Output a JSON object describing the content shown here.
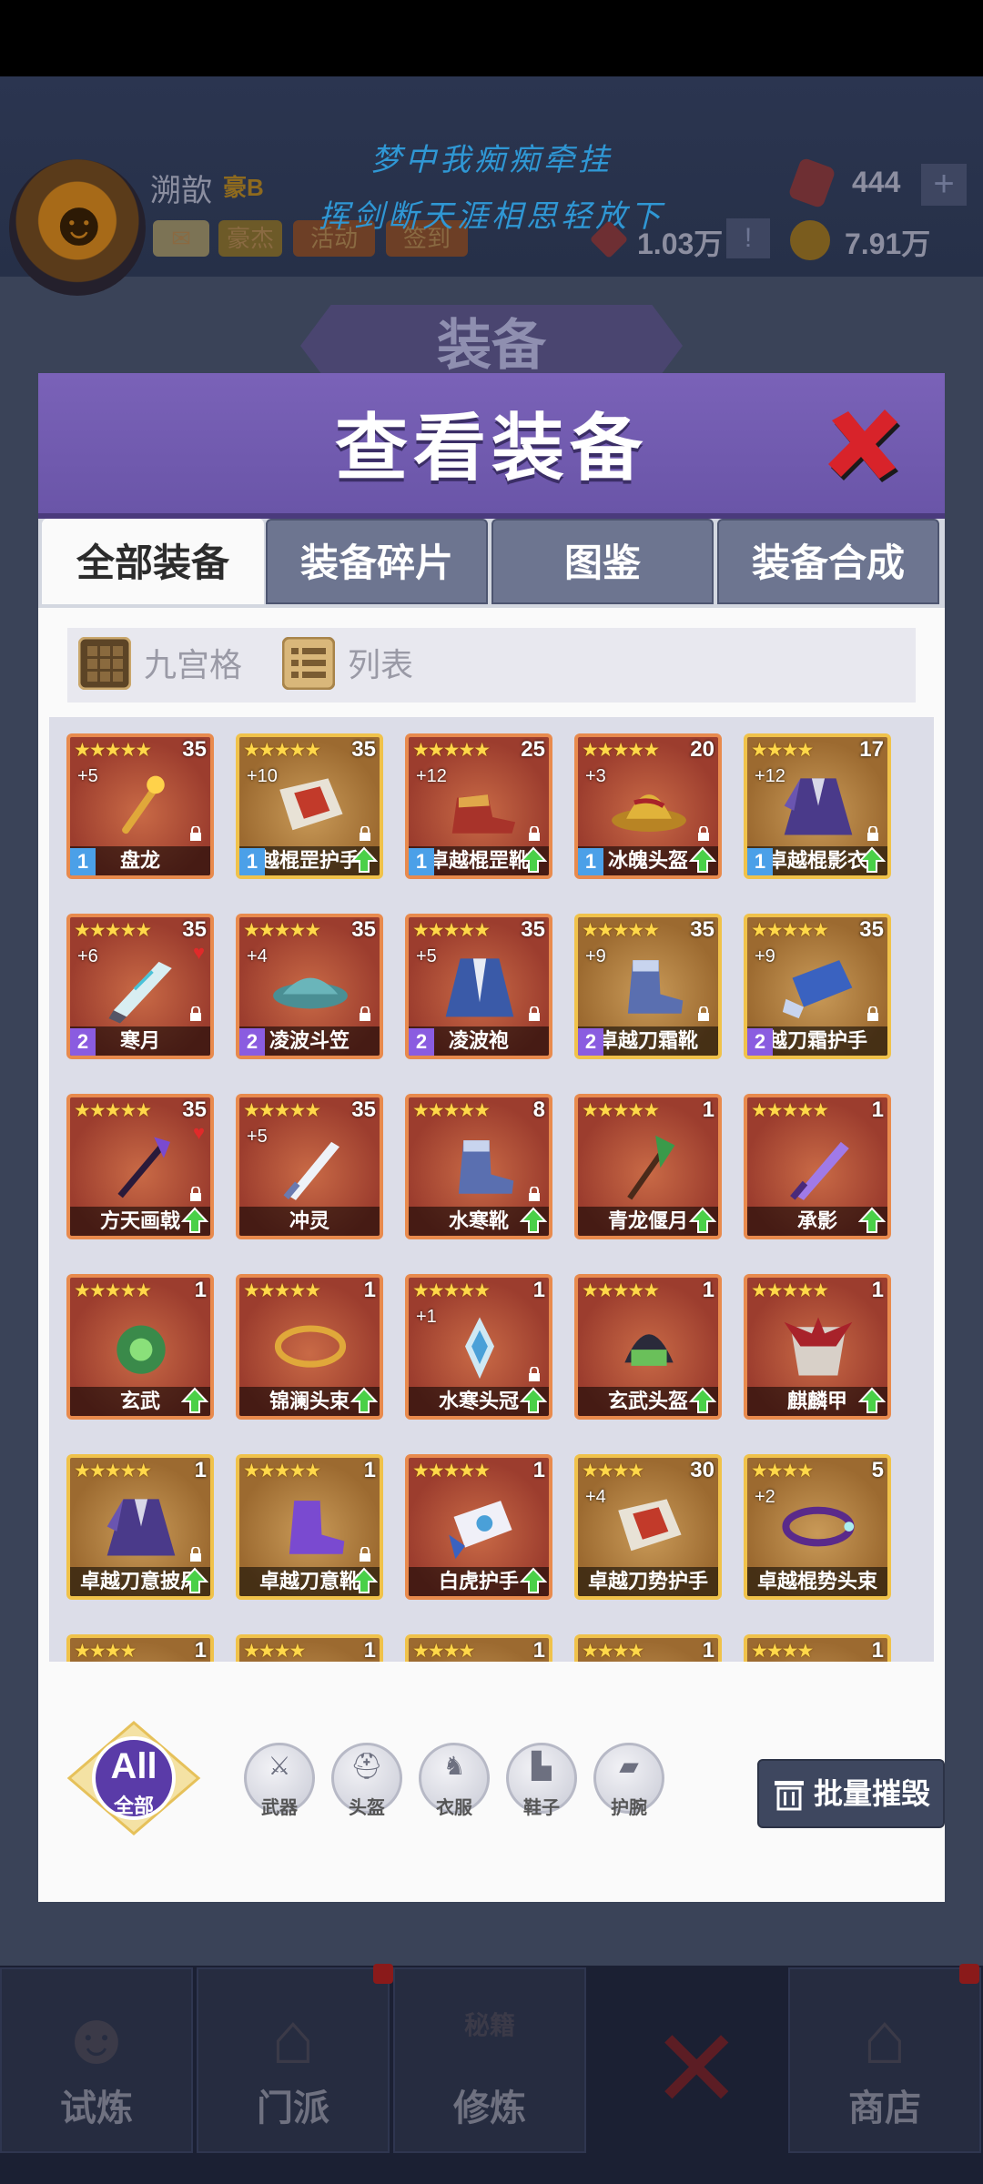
{
  "background": {
    "player_name": "溯歆",
    "player_rank": "豪B",
    "buttons": {
      "hero": "豪杰",
      "activity": "活动",
      "signin": "签到"
    },
    "poem_line1": "梦中我痴痴牵挂",
    "poem_line2": "挥剑断天涯相思轻放下",
    "gems": "444",
    "power": "1.03万",
    "coins": "7.91万",
    "screen_title": "装备",
    "nav": {
      "trial": "试炼",
      "sect": "门派",
      "cultivate": "修炼",
      "shop": "商店",
      "secret_book": "秘籍"
    }
  },
  "modal": {
    "title": "查看装备",
    "tabs": [
      "全部装备",
      "装备碎片",
      "图鉴",
      "装备合成"
    ],
    "active_tab": 0,
    "view_options": {
      "grid": "九宫格",
      "list": "列表"
    },
    "items": [
      {
        "stars": "★★★★★",
        "level": "35",
        "plus": "+5",
        "name": "盘龙",
        "badge": "1",
        "lock": true,
        "upgrade": false,
        "frame": "orange",
        "art": "staff-gold"
      },
      {
        "stars": "★★★★★",
        "level": "35",
        "plus": "+10",
        "name": "越棍罡护手",
        "badge": "1",
        "lock": true,
        "upgrade": true,
        "frame": "gold",
        "art": "bracer-red"
      },
      {
        "stars": "★★★★★",
        "level": "25",
        "plus": "+12",
        "name": "卓越棍罡靴",
        "badge": "1",
        "lock": true,
        "upgrade": true,
        "frame": "orange",
        "art": "boot-red"
      },
      {
        "stars": "★★★★★",
        "level": "20",
        "plus": "+3",
        "name": "冰魄头盔",
        "badge": "1",
        "lock": true,
        "upgrade": true,
        "frame": "orange",
        "art": "hat-gold"
      },
      {
        "stars": "★★★★",
        "level": "17",
        "plus": "+12",
        "name": "卓越棍影衣",
        "badge": "1",
        "lock": true,
        "upgrade": true,
        "frame": "gold",
        "art": "robe-purple"
      },
      {
        "stars": "★★★★★",
        "level": "35",
        "plus": "+6",
        "name": "寒月",
        "badge": "2",
        "lock": true,
        "upgrade": false,
        "heart": true,
        "frame": "orange",
        "art": "blade-ice"
      },
      {
        "stars": "★★★★★",
        "level": "35",
        "plus": "+4",
        "name": "凌波斗笠",
        "badge": "2",
        "lock": true,
        "upgrade": false,
        "frame": "orange",
        "art": "hat-teal"
      },
      {
        "stars": "★★★★★",
        "level": "35",
        "plus": "+5",
        "name": "凌波袍",
        "badge": "2",
        "lock": true,
        "upgrade": false,
        "frame": "orange",
        "art": "robe-blue"
      },
      {
        "stars": "★★★★★",
        "level": "35",
        "plus": "+9",
        "name": "卓越刀霜靴",
        "badge": "2",
        "lock": true,
        "upgrade": false,
        "frame": "gold",
        "art": "boot-blue"
      },
      {
        "stars": "★★★★★",
        "level": "35",
        "plus": "+9",
        "name": "越刀霜护手",
        "badge": "2",
        "lock": true,
        "upgrade": false,
        "frame": "gold",
        "art": "bracer-blue"
      },
      {
        "stars": "★★★★★",
        "level": "35",
        "plus": "",
        "name": "方天画戟",
        "badge": "",
        "lock": true,
        "upgrade": true,
        "heart": true,
        "frame": "orange",
        "art": "halberd"
      },
      {
        "stars": "★★★★★",
        "level": "35",
        "plus": "+5",
        "name": "冲灵",
        "badge": "",
        "lock": false,
        "upgrade": false,
        "frame": "orange",
        "art": "sword-silver"
      },
      {
        "stars": "★★★★★",
        "level": "8",
        "plus": "",
        "name": "水寒靴",
        "badge": "",
        "lock": true,
        "upgrade": true,
        "frame": "orange",
        "art": "boot-blue"
      },
      {
        "stars": "★★★★★",
        "level": "1",
        "plus": "",
        "name": "青龙偃月",
        "badge": "",
        "lock": false,
        "upgrade": true,
        "frame": "orange",
        "art": "glaive-green"
      },
      {
        "stars": "★★★★★",
        "level": "1",
        "plus": "",
        "name": "承影",
        "badge": "",
        "lock": false,
        "upgrade": true,
        "frame": "orange",
        "art": "sword-purple"
      },
      {
        "stars": "★★★★★",
        "level": "1",
        "plus": "",
        "name": "玄武",
        "badge": "",
        "lock": false,
        "upgrade": true,
        "frame": "orange",
        "art": "claw-green"
      },
      {
        "stars": "★★★★★",
        "level": "1",
        "plus": "",
        "name": "锦澜头束",
        "badge": "",
        "lock": false,
        "upgrade": true,
        "frame": "orange",
        "art": "band-gold"
      },
      {
        "stars": "★★★★★",
        "level": "1",
        "plus": "+1",
        "name": "水寒头冠",
        "badge": "",
        "lock": true,
        "upgrade": true,
        "frame": "orange",
        "art": "crown-blue"
      },
      {
        "stars": "★★★★★",
        "level": "1",
        "plus": "",
        "name": "玄武头盔",
        "badge": "",
        "lock": false,
        "upgrade": true,
        "frame": "orange",
        "art": "helm-green"
      },
      {
        "stars": "★★★★★",
        "level": "1",
        "plus": "",
        "name": "麒麟甲",
        "badge": "",
        "lock": false,
        "upgrade": true,
        "frame": "orange",
        "art": "armor-red"
      },
      {
        "stars": "★★★★★",
        "level": "1",
        "plus": "",
        "name": "卓越刀意披风",
        "badge": "",
        "lock": true,
        "upgrade": true,
        "frame": "gold",
        "art": "robe-purple"
      },
      {
        "stars": "★★★★★",
        "level": "1",
        "plus": "",
        "name": "卓越刀意靴",
        "badge": "",
        "lock": true,
        "upgrade": true,
        "frame": "gold",
        "art": "boot-purple"
      },
      {
        "stars": "★★★★★",
        "level": "1",
        "plus": "",
        "name": "白虎护手",
        "badge": "",
        "lock": false,
        "upgrade": true,
        "frame": "orange",
        "art": "bracer-white"
      },
      {
        "stars": "★★★★",
        "level": "30",
        "plus": "+4",
        "name": "卓越刀势护手",
        "badge": "",
        "lock": false,
        "upgrade": false,
        "frame": "gold",
        "art": "bracer-red"
      },
      {
        "stars": "★★★★",
        "level": "5",
        "plus": "+2",
        "name": "卓越棍势头束",
        "badge": "",
        "lock": false,
        "upgrade": false,
        "frame": "gold",
        "art": "band-purple"
      },
      {
        "stars": "★★★★",
        "level": "1",
        "plus": "",
        "name": "",
        "badge": "",
        "lock": false,
        "upgrade": false,
        "frame": "gold",
        "art": "staff-gold"
      },
      {
        "stars": "★★★★",
        "level": "1",
        "plus": "",
        "name": "",
        "badge": "",
        "lock": false,
        "upgrade": false,
        "frame": "gold",
        "art": "sword-silver"
      },
      {
        "stars": "★★★★",
        "level": "1",
        "plus": "",
        "name": "",
        "badge": "",
        "lock": false,
        "upgrade": false,
        "frame": "gold",
        "art": "sword-silver"
      },
      {
        "stars": "★★★★",
        "level": "1",
        "plus": "",
        "name": "",
        "badge": "",
        "lock": false,
        "upgrade": false,
        "frame": "gold",
        "art": "claw-red"
      },
      {
        "stars": "★★★★",
        "level": "1",
        "plus": "",
        "name": "",
        "badge": "",
        "lock": false,
        "upgrade": false,
        "frame": "gold",
        "art": "fist-gold"
      }
    ],
    "filters": {
      "all_top": "All",
      "all_bottom": "全部",
      "buttons": [
        {
          "label": "武器",
          "icon": "sword-icon"
        },
        {
          "label": "头盔",
          "icon": "helmet-icon"
        },
        {
          "label": "衣服",
          "icon": "robe-icon"
        },
        {
          "label": "鞋子",
          "icon": "boot-icon"
        },
        {
          "label": "护腕",
          "icon": "bracer-icon"
        }
      ]
    },
    "batch_destroy": "批量摧毁"
  },
  "colors": {
    "header": "#7a62b8",
    "frame_orange": "#e88a4d",
    "frame_gold": "#f0c24a",
    "star": "#ffd84a"
  }
}
